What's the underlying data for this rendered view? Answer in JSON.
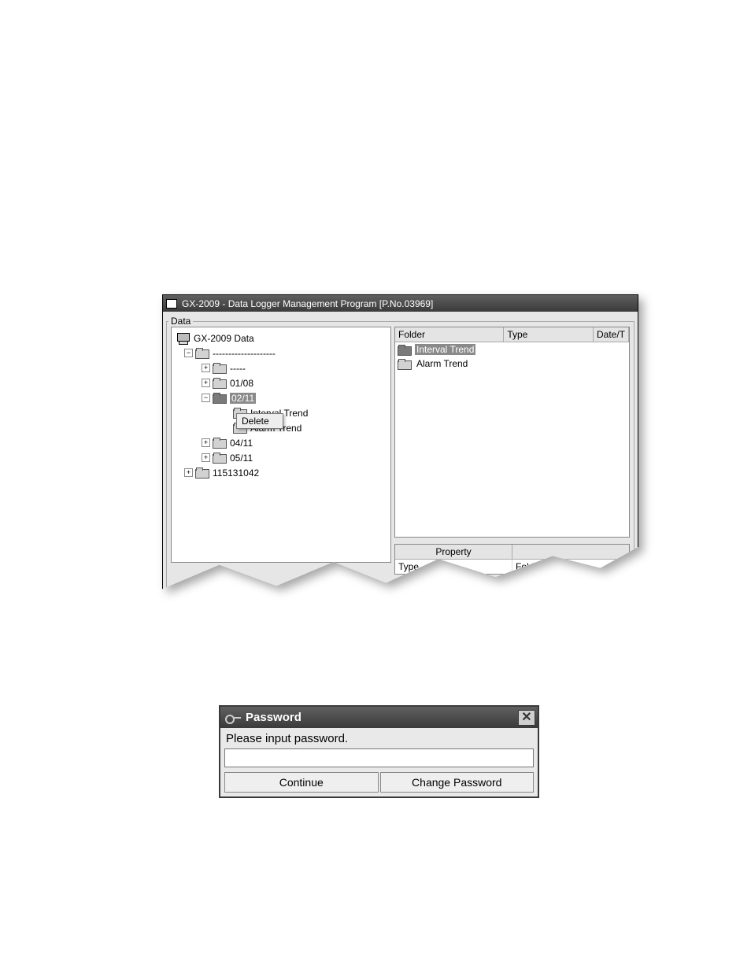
{
  "window": {
    "title": "GX-2009  - Data Logger Management Program [P.No.03969]",
    "data_label": "Data"
  },
  "tree": {
    "root": "GX-2009 Data",
    "unit_group": "--------------------",
    "items": {
      "blank": "-----",
      "n01_08": "01/08",
      "n02_11": "02/11",
      "interval_trend": "Interval Trend",
      "alarm_trend": "Alarm Trend",
      "n04_11": "04/11",
      "n05_11": "05/11",
      "serial": "115131042"
    }
  },
  "context_menu": {
    "delete": "Delete"
  },
  "list": {
    "headers": {
      "folder": "Folder",
      "type": "Type",
      "date": "Date/T"
    },
    "rows": {
      "interval": "Interval Trend",
      "alarm": "Alarm Trend"
    }
  },
  "property": {
    "header": "Property",
    "type_label": "Type",
    "type_value": "Folder"
  },
  "password_dlg": {
    "title": "Password",
    "prompt": "Please input password.",
    "continue": "Continue",
    "change": "Change Password",
    "close": "✕"
  }
}
